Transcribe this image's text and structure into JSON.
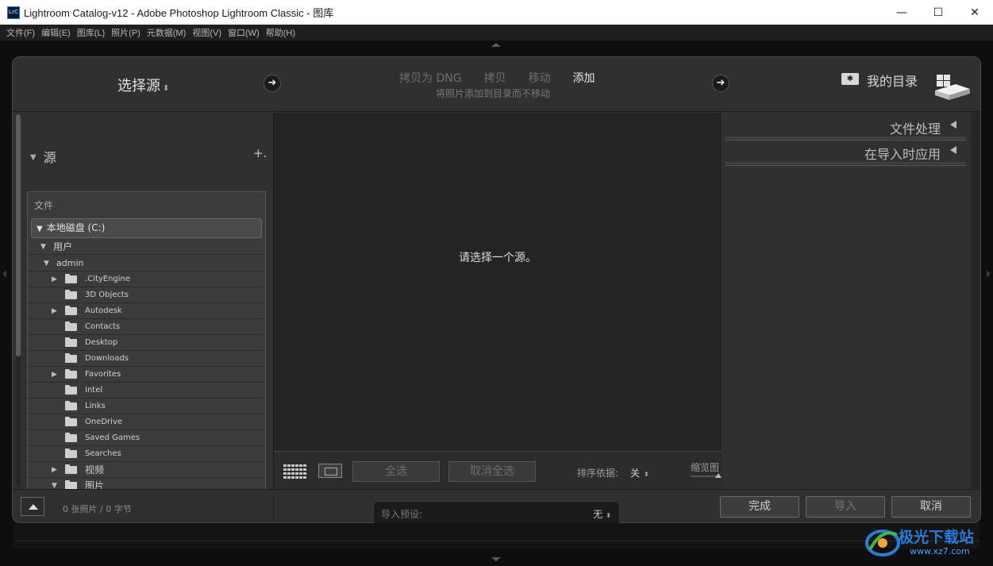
{
  "window": {
    "logo_text": "LrC",
    "title": "Lightroom Catalog-v12 - Adobe Photoshop Lightroom Classic - 图库",
    "minimize_label": "—",
    "maximize_label": "☐",
    "close_label": "✕"
  },
  "menu": {
    "items": [
      "文件(F)",
      "编辑(E)",
      "图库(L)",
      "照片(P)",
      "元数据(M)",
      "视图(V)",
      "窗口(W)",
      "帮助(H)"
    ]
  },
  "header": {
    "select_source": "选择源",
    "modes": [
      "拷贝为 DNG",
      "拷贝",
      "移动",
      "添加"
    ],
    "active_mode": "添加",
    "mode_description": "将照片添加到目录而不移动",
    "destination_label": "我的目录"
  },
  "source_panel": {
    "title": "源",
    "add_label": "+.",
    "files_title": "文件",
    "drive": "本地磁盘 (C:)",
    "tree": [
      {
        "label": "用户",
        "level": 1,
        "expanded": true
      },
      {
        "label": "admin",
        "level": 2,
        "expanded": true
      },
      {
        "label": ".CityEngine",
        "level": 3,
        "has_children": true
      },
      {
        "label": "3D Objects",
        "level": 3,
        "has_children": false
      },
      {
        "label": "Autodesk",
        "level": 3,
        "has_children": true
      },
      {
        "label": "Contacts",
        "level": 3,
        "has_children": false
      },
      {
        "label": "Desktop",
        "level": 3,
        "has_children": false
      },
      {
        "label": "Downloads",
        "level": 3,
        "has_children": false
      },
      {
        "label": "Favorites",
        "level": 3,
        "has_children": true
      },
      {
        "label": "Intel",
        "level": 3,
        "has_children": false
      },
      {
        "label": "Links",
        "level": 3,
        "has_children": false
      },
      {
        "label": "OneDrive",
        "level": 3,
        "has_children": false
      },
      {
        "label": "Saved Games",
        "level": 3,
        "has_children": false
      },
      {
        "label": "Searches",
        "level": 3,
        "has_children": false
      },
      {
        "label": "视频",
        "level": 3,
        "has_children": true
      },
      {
        "label": "图片",
        "level": 3,
        "has_children": true,
        "expanded": true
      }
    ]
  },
  "center": {
    "message": "请选择一个源。",
    "select_all": "全选",
    "deselect_all": "取消全选",
    "sort_label": "排序依据:",
    "sort_value": "关",
    "thumbnail_label": "缩览图"
  },
  "right_panel": {
    "sections": [
      "文件处理",
      "在导入时应用"
    ]
  },
  "footer": {
    "photo_count": "0 张照片 / 0 字节",
    "preset_label": "导入预设:",
    "preset_value": "无",
    "done": "完成",
    "import": "导入",
    "cancel": "取消"
  },
  "watermark": {
    "text": "极光下载站",
    "url": "www.xz7.com"
  },
  "colors": {
    "dialog_bg": "#303030",
    "center_bg": "#242424",
    "watermark_blue": "#2b7cd8"
  }
}
